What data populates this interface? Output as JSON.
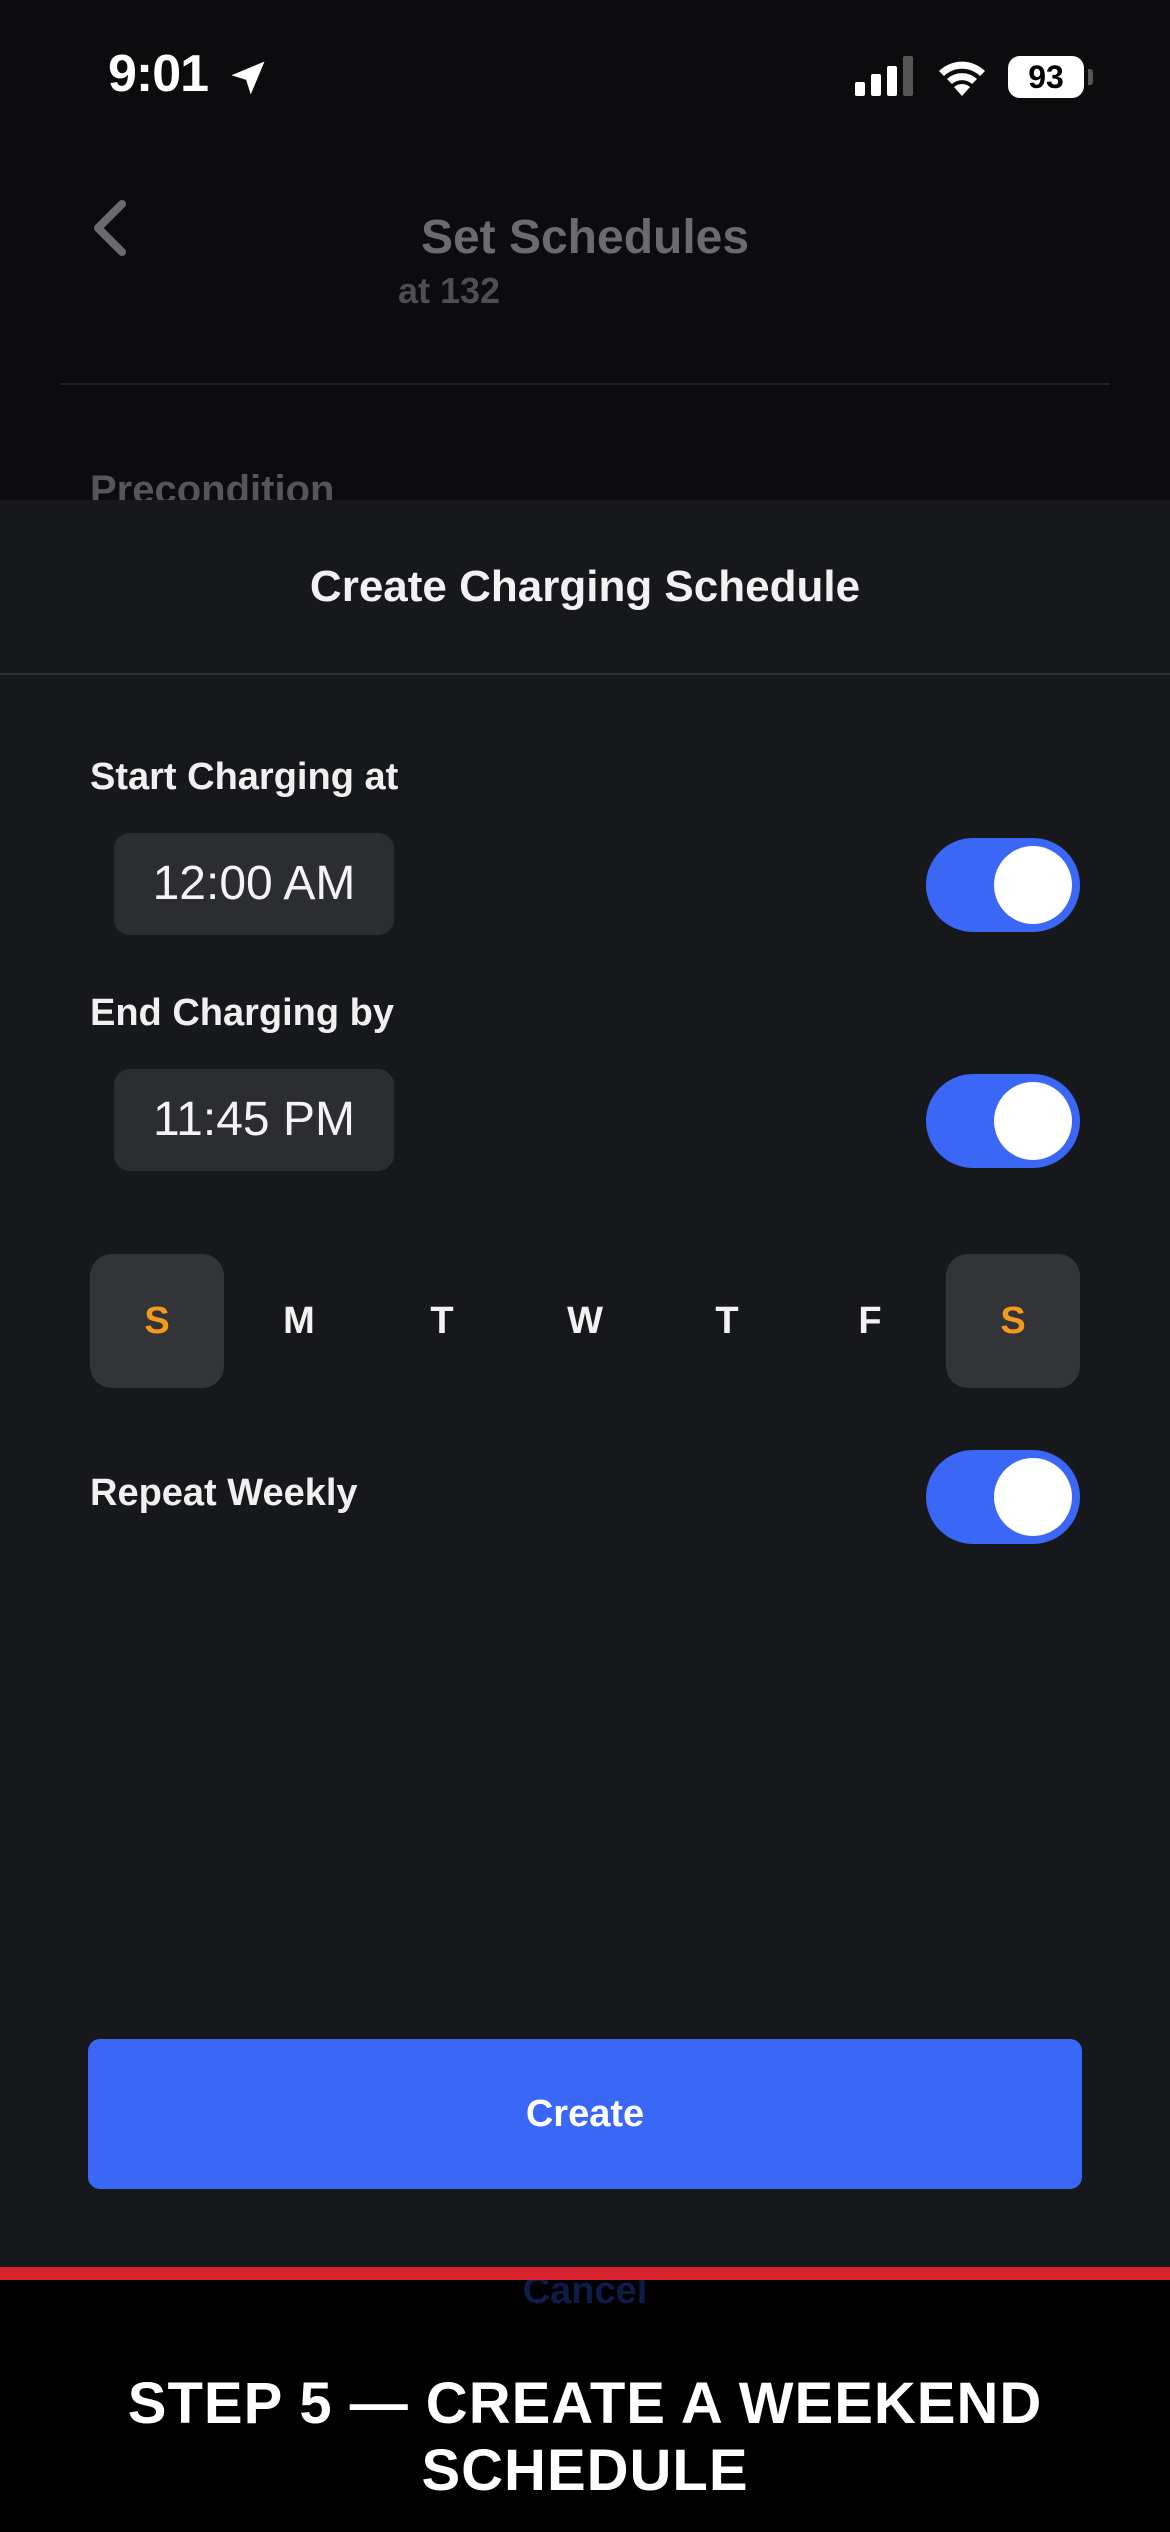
{
  "status_bar": {
    "time": "9:01",
    "battery": "93",
    "icons": [
      "location-arrow-icon",
      "cellular-signal-icon",
      "wifi-icon",
      "battery-icon"
    ]
  },
  "background_page": {
    "title": "Set Schedules",
    "subtitle": "at 132",
    "section_label": "Precondition"
  },
  "sheet": {
    "title": "Create Charging Schedule",
    "start": {
      "label": "Start Charging at",
      "time": "12:00 AM",
      "enabled": true
    },
    "end": {
      "label": "End Charging by",
      "time": "11:45 PM",
      "enabled": true
    },
    "days": [
      {
        "label": "S",
        "selected": true
      },
      {
        "label": "M",
        "selected": false
      },
      {
        "label": "T",
        "selected": false
      },
      {
        "label": "W",
        "selected": false
      },
      {
        "label": "T",
        "selected": false
      },
      {
        "label": "F",
        "selected": false
      },
      {
        "label": "S",
        "selected": true
      }
    ],
    "repeat": {
      "label": "Repeat Weekly",
      "enabled": true
    },
    "create_label": "Create",
    "cancel_label": "Cancel"
  },
  "caption": "STEP 5 — CREATE A WEEKEND SCHEDULE",
  "colors": {
    "accent": "#3a67f6",
    "selected_day": "#f39a1e",
    "caption_rule": "#d6232e"
  }
}
